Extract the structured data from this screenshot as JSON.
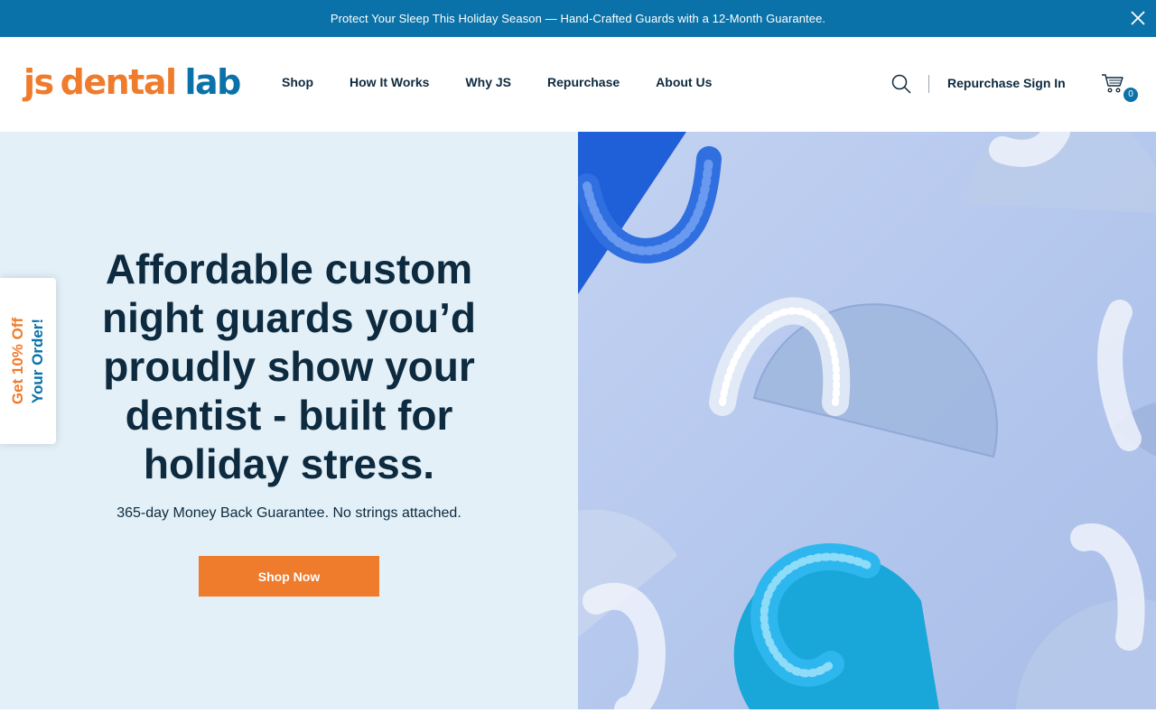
{
  "announcement": {
    "text": "Protect Your Sleep This Holiday Season — Hand-Crafted Guards with a 12-Month Guarantee.",
    "close_icon": "close-icon",
    "background": "#0a72a8"
  },
  "header": {
    "logo": {
      "part1": "js",
      "part2": "dental",
      "part3": "lab"
    },
    "nav": [
      "Shop",
      "How It Works",
      "Why JS",
      "Repurchase",
      "About Us"
    ],
    "search_icon": "search-icon",
    "signin_label": "Repurchase Sign In",
    "cart_icon": "cart-icon",
    "cart_count": "0"
  },
  "hero": {
    "title": "Affordable custom night guards you’d proudly show your dentist - built for holiday stress.",
    "subtitle": "365-day Money Back Guarantee. No strings attached.",
    "cta_label": "Shop Now"
  },
  "side_tab": {
    "line1": "Get 10% Off",
    "line2": "Your Order!"
  },
  "colors": {
    "brand_orange": "#ef7b2c",
    "brand_blue": "#0a72a8",
    "text_dark": "#0d2a3f",
    "hero_bg": "#e3f0f8"
  }
}
